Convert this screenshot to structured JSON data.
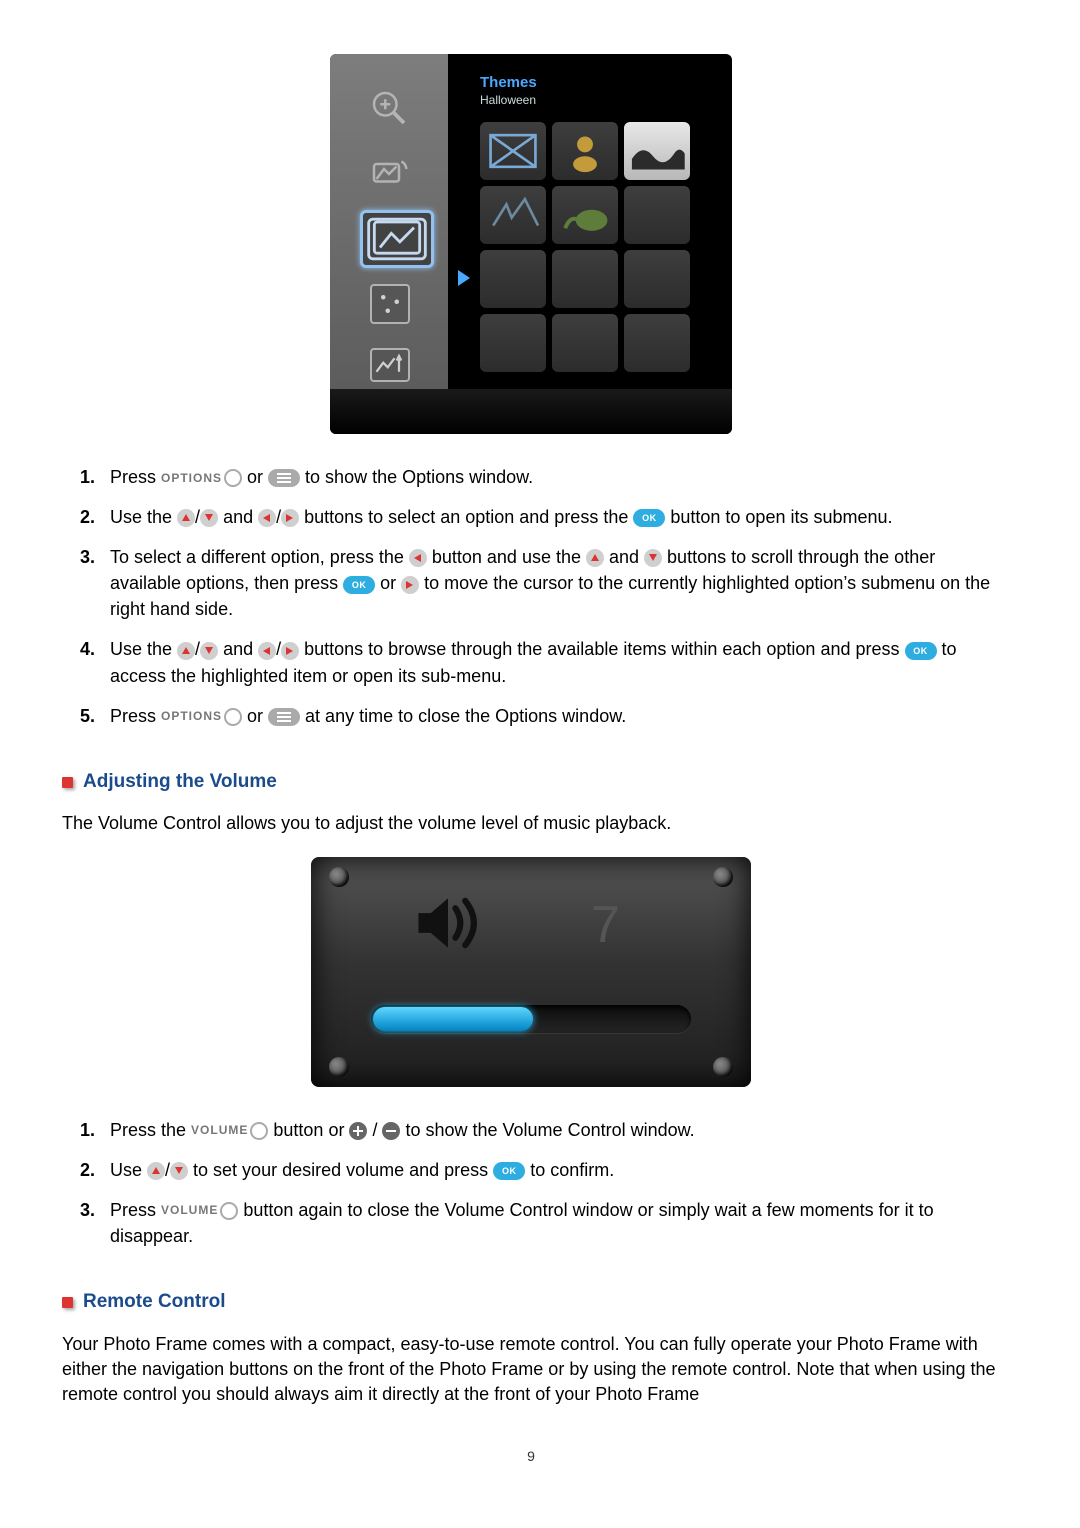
{
  "themes_panel": {
    "title": "Themes",
    "subtitle": "Halloween"
  },
  "options_steps": [
    {
      "segments": [
        {
          "t": "text",
          "v": "Press "
        },
        {
          "t": "lbl",
          "v": "OPTIONS"
        },
        {
          "t": "ring"
        },
        {
          "t": "text",
          "v": " or "
        },
        {
          "t": "pill-menu"
        },
        {
          "t": "text",
          "v": " to show the Options window."
        }
      ]
    },
    {
      "segments": [
        {
          "t": "text",
          "v": "Use the "
        },
        {
          "t": "disc-up"
        },
        {
          "t": "text",
          "v": "/"
        },
        {
          "t": "disc-down"
        },
        {
          "t": "text",
          "v": " and "
        },
        {
          "t": "disc-left"
        },
        {
          "t": "text",
          "v": "/"
        },
        {
          "t": "disc-right"
        },
        {
          "t": "text",
          "v": " buttons to select an option and press the "
        },
        {
          "t": "pill-ok"
        },
        {
          "t": "text",
          "v": " button to open its submenu."
        }
      ]
    },
    {
      "segments": [
        {
          "t": "text",
          "v": "To select a different option, press the "
        },
        {
          "t": "disc-left"
        },
        {
          "t": "text",
          "v": " button and use the "
        },
        {
          "t": "disc-up"
        },
        {
          "t": "text",
          "v": " and "
        },
        {
          "t": "disc-down"
        },
        {
          "t": "text",
          "v": " buttons to scroll through the other available options, then press "
        },
        {
          "t": "pill-ok"
        },
        {
          "t": "text",
          "v": " or "
        },
        {
          "t": "disc-right"
        },
        {
          "t": "text",
          "v": " to move the cursor to the currently highlighted option’s submenu on the right hand side."
        }
      ]
    },
    {
      "segments": [
        {
          "t": "text",
          "v": "Use the "
        },
        {
          "t": "disc-up"
        },
        {
          "t": "text",
          "v": "/"
        },
        {
          "t": "disc-down"
        },
        {
          "t": "text",
          "v": " and "
        },
        {
          "t": "disc-left"
        },
        {
          "t": "text",
          "v": "/"
        },
        {
          "t": "disc-right"
        },
        {
          "t": "text",
          "v": " buttons to browse through the available items within each option and press "
        },
        {
          "t": "pill-ok"
        },
        {
          "t": "text",
          "v": " to access the highlighted item or open its sub-menu."
        }
      ]
    },
    {
      "segments": [
        {
          "t": "text",
          "v": "Press "
        },
        {
          "t": "lbl",
          "v": "OPTIONS"
        },
        {
          "t": "ring"
        },
        {
          "t": "text",
          "v": " or "
        },
        {
          "t": "pill-menu"
        },
        {
          "t": "text",
          "v": " at any time to close the Options window."
        }
      ]
    }
  ],
  "volume_heading": "Adjusting the Volume",
  "volume_intro": "The Volume Control allows you to adjust the volume level of music playback.",
  "volume_panel": {
    "value": "7"
  },
  "volume_steps": [
    {
      "segments": [
        {
          "t": "text",
          "v": "Press the "
        },
        {
          "t": "lbl",
          "v": "VOLUME"
        },
        {
          "t": "ring"
        },
        {
          "t": "text",
          "v": " button or "
        },
        {
          "t": "disc-plus"
        },
        {
          "t": "text",
          "v": " / "
        },
        {
          "t": "disc-minus"
        },
        {
          "t": "text",
          "v": " to show the Volume Control window."
        }
      ]
    },
    {
      "segments": [
        {
          "t": "text",
          "v": "Use "
        },
        {
          "t": "disc-up"
        },
        {
          "t": "text",
          "v": "/"
        },
        {
          "t": "disc-down"
        },
        {
          "t": "text",
          "v": " to set your desired volume and press "
        },
        {
          "t": "pill-ok"
        },
        {
          "t": "text",
          "v": " to confirm."
        }
      ]
    },
    {
      "segments": [
        {
          "t": "text",
          "v": "Press "
        },
        {
          "t": "lbl",
          "v": "VOLUME"
        },
        {
          "t": "ring"
        },
        {
          "t": "text",
          "v": " button again to close the Volume Control window or simply wait a few moments for it to disappear."
        }
      ]
    }
  ],
  "remote_heading": "Remote Control",
  "remote_para": "Your Photo Frame comes with a compact, easy-to-use remote control. You can fully operate your Photo Frame with either the navigation buttons on the front of the Photo Frame or by using the remote control. Note that when using the remote control you should always aim it directly at the front of your Photo Frame",
  "page_number": "9"
}
